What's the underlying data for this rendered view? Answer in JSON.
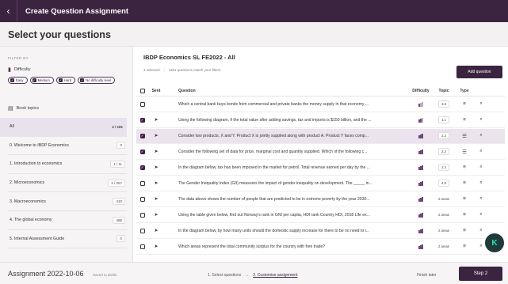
{
  "topbar": {
    "back_glyph": "‹",
    "title": "Create Question Assignment"
  },
  "page": {
    "heading": "Select your questions"
  },
  "sidebar": {
    "filter_by": "FILTER BY",
    "difficulty_label": "Difficulty",
    "chips": [
      {
        "label": "Easy",
        "checked": true
      },
      {
        "label": "Medium",
        "checked": true
      },
      {
        "label": "Hard",
        "checked": true
      },
      {
        "label": "No difficulty level",
        "checked": true
      }
    ],
    "book_topics_label": "Book topics",
    "topics": [
      {
        "label": "All",
        "count": "4 / 181",
        "active": true
      },
      {
        "label": "0. Welcome to IBDP Economics",
        "count": "0"
      },
      {
        "label": "1. Introduction to economics",
        "count": "1 / 11"
      },
      {
        "label": "2. Microeconomics",
        "count": "3 / 257"
      },
      {
        "label": "3. Macroeconomics",
        "count": "410"
      },
      {
        "label": "4. The global economy",
        "count": "486"
      },
      {
        "label": "5. Internal Assessment Guide",
        "count": "0"
      }
    ]
  },
  "main": {
    "set_title": "IBDP Economics SL FE2022 - All",
    "selected_text": "4 selected",
    "match_text": "1181 questions match your filters",
    "add_button": "Add question",
    "columns": {
      "sent": "Sent",
      "question": "Question",
      "difficulty": "Difficulty",
      "topic": "Topic",
      "type": "Type"
    },
    "rows": [
      {
        "checked": false,
        "sent": false,
        "question": "Which a central bank buys bonds from commercial and private banks the money supply in that economy ...",
        "difficulty": 1,
        "topic": "3.6",
        "type": "text"
      },
      {
        "checked": true,
        "sent": true,
        "question": "Using the following diagram, if the total value after adding savings, tax and imports is $150 billion, and the ...",
        "difficulty": 2,
        "topic": "1.1",
        "type": "text"
      },
      {
        "checked": true,
        "sent": true,
        "question": "Consider two products, X and Y. Product X is jointly supplied along with product A. Product Y faces comp...",
        "difficulty": 3,
        "topic": "2.2",
        "type": "list",
        "selected": true
      },
      {
        "checked": true,
        "sent": true,
        "question": "Consider the following set of data for price, marginal cost and quantity supplied. Which of the following c...",
        "difficulty": 3,
        "topic": "2.2",
        "type": "list"
      },
      {
        "checked": true,
        "sent": true,
        "question": "In the diagram below, tax has been imposed in the market for petrol. Total revenue earned per day by the ...",
        "difficulty": 3,
        "topic": "2.2",
        "type": "text"
      },
      {
        "checked": false,
        "sent": true,
        "question": "The Gender Inequality Index (GII) measures the impact of gender inequality on development. The _____ in...",
        "difficulty": 3,
        "topic": "4.8",
        "type": "text"
      },
      {
        "checked": false,
        "sent": true,
        "question": "The data above shows the number of people that are predicted to be in extreme poverty by the year 2030...",
        "difficulty": 3,
        "topic": "2 areas",
        "type": "text"
      },
      {
        "checked": false,
        "sent": true,
        "question": "Using the table given below, find out Norway's rank in GNI per capita, HDI rank Country HDI, 2018 Life ex...",
        "difficulty": 3,
        "topic": "2 areas",
        "type": "text"
      },
      {
        "checked": false,
        "sent": true,
        "question": "In the diagram below, by how many units should the domestic supply increase for there to be no need to i...",
        "difficulty": 3,
        "topic": "2 areas",
        "type": "text"
      },
      {
        "checked": false,
        "sent": true,
        "question": "Which areas represent the total community surplus for the country with free trade?",
        "difficulty": 3,
        "topic": "2 areas",
        "type": "text"
      }
    ]
  },
  "bottombar": {
    "assignment": "Assignment 2022-10-06",
    "saved": "Saved to drafts",
    "step1": "1. Select questions",
    "arrow": "→",
    "step2": "2. Customise assignment",
    "finish_later": "Finish later",
    "step_button": "Step 2"
  },
  "fab_label": "K",
  "colors": {
    "brand": "#3b2440",
    "selected_row": "#ece3ef",
    "fab": "#1e3b3a",
    "fab_glyph": "#2fe0b5"
  }
}
